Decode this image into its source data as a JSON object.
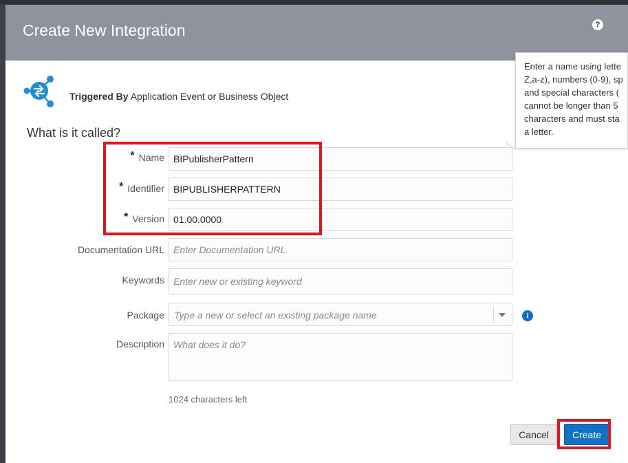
{
  "dialog": {
    "title": "Create New Integration",
    "help_icon": "question-icon",
    "help_glyph": "?"
  },
  "trigger": {
    "icon": "integration-trigger-icon",
    "bold_label": "Triggered By",
    "text": " Application Event or Business Object"
  },
  "section_title": "What is it called?",
  "required_marker": "*",
  "fields": {
    "name": {
      "label": "Name",
      "value": "BIPublisherPattern"
    },
    "identifier": {
      "label": "Identifier",
      "value": "BIPUBLISHERPATTERN"
    },
    "version": {
      "label": "Version",
      "value": "01.00.0000"
    },
    "documentation_url": {
      "label": "Documentation URL",
      "placeholder": "Enter Documentation URL"
    },
    "keywords": {
      "label": "Keywords",
      "placeholder": "Enter new or existing keyword"
    },
    "package": {
      "label": "Package",
      "placeholder": "Type a new or select an existing package name"
    },
    "description": {
      "label": "Description",
      "placeholder": "What does it do?"
    }
  },
  "package_info_icon": "info-icon",
  "package_info_glyph": "i",
  "chars_left": "1024 characters left",
  "buttons": {
    "cancel": "Cancel",
    "create": "Create"
  },
  "tooltip": {
    "lines": [
      "Enter a name using lette",
      "Z,a-z), numbers (0-9), sp",
      "and special characters (",
      "cannot be longer than 5",
      "characters and must sta",
      "a letter."
    ]
  },
  "colors": {
    "header": "#8f939e",
    "primary_button": "#0f72c7",
    "highlight": "#e8141c",
    "trigger_icon": "#1a8fd6"
  }
}
